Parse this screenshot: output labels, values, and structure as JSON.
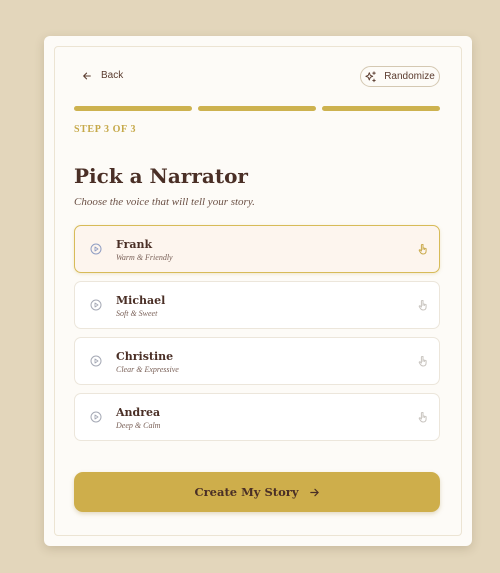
{
  "nav": {
    "back_label": "Back",
    "randomize_label": "Randomize"
  },
  "progress": {
    "current_step": 3,
    "total_steps": 3
  },
  "step_label": "STEP 3 OF 3",
  "title": "Pick a Narrator",
  "subtitle": "Choose the voice that will tell your story.",
  "narrators": [
    {
      "name": "Frank",
      "description": "Warm & Friendly",
      "selected": true
    },
    {
      "name": "Michael",
      "description": "Soft & Sweet",
      "selected": false
    },
    {
      "name": "Christine",
      "description": "Clear & Expressive",
      "selected": false
    },
    {
      "name": "Andrea",
      "description": "Deep & Calm",
      "selected": false
    }
  ],
  "cta_label": "Create My Story",
  "icons": {
    "back": "arrow-left-icon",
    "randomize": "sparkles-icon",
    "play": "play-circle-icon",
    "select": "hand-pointer-icon",
    "cta": "arrow-right-icon"
  },
  "colors": {
    "accent": "#cdb24f",
    "background": "#e3d6bb",
    "text": "#4a2f26",
    "selected_bg": "#fdf5ee"
  }
}
